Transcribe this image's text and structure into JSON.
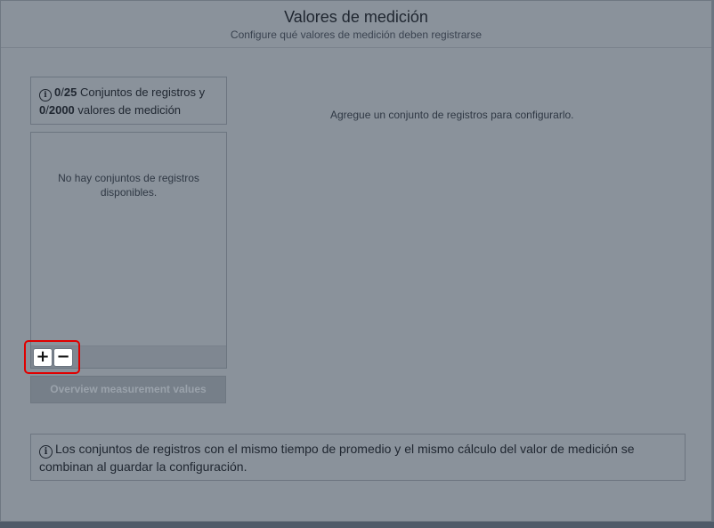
{
  "dialog": {
    "title": "Valores de medición",
    "subtitle": "Configure qué valores de medición deben registrarse"
  },
  "counter": {
    "sets_current": "0",
    "sets_max": "25",
    "sets_label": "Conjuntos de registros y",
    "values_current": "0",
    "values_max": "2000",
    "values_label": "valores de medición",
    "separator": "/"
  },
  "list": {
    "empty_text": "No hay conjuntos de registros disponibles.",
    "add_label": "+",
    "remove_label": "−"
  },
  "overview_button": {
    "label": "Overview measurement values"
  },
  "main": {
    "hint": "Agregue un conjunto de registros para configurarlo."
  },
  "footer": {
    "info_text": "Los conjuntos de registros con el mismo tiempo de promedio y el mismo cálculo del valor de medición se combinan al guardar la configuración."
  },
  "icons": {
    "info": "info-icon"
  },
  "colors": {
    "highlight": "#e00000"
  }
}
